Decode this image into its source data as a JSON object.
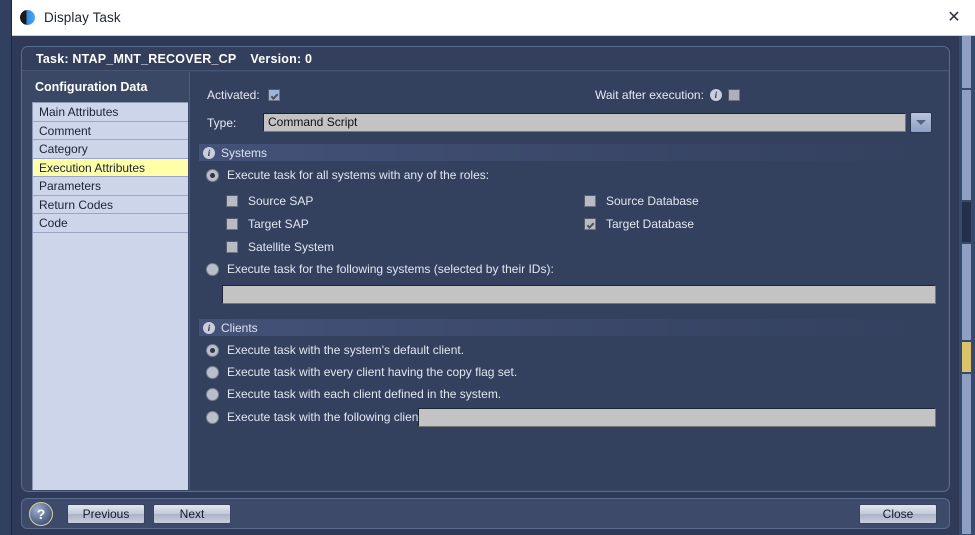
{
  "window": {
    "title": "Display Task",
    "app_icon": "app-circle-icon",
    "close_icon": "close-icon"
  },
  "panel": {
    "task_label": "Task: NTAP_MNT_RECOVER_CP",
    "version_label": "Version: 0"
  },
  "sidebar": {
    "title": "Configuration Data",
    "items": [
      {
        "label": "Main Attributes",
        "active": false
      },
      {
        "label": "Comment",
        "active": false
      },
      {
        "label": "Category",
        "active": false
      },
      {
        "label": "Execution Attributes",
        "active": true
      },
      {
        "label": "Parameters",
        "active": false
      },
      {
        "label": "Return Codes",
        "active": false
      },
      {
        "label": "Code",
        "active": false
      }
    ]
  },
  "form": {
    "activated_label": "Activated:",
    "activated_checked": true,
    "wait_label": "Wait after execution:",
    "wait_checked": false,
    "type_label": "Type:",
    "type_value": "Command Script",
    "dropdown_icon": "chevron-down-icon",
    "info_icon": "info-icon"
  },
  "systems": {
    "title": "Systems",
    "option_roles": "Execute task for all systems with any of the roles:",
    "option_roles_selected": true,
    "roles_left": [
      {
        "label": "Source SAP",
        "checked": false
      },
      {
        "label": "Target SAP",
        "checked": false
      },
      {
        "label": "Satellite System",
        "checked": false
      }
    ],
    "roles_right": [
      {
        "label": "Source Database",
        "checked": false
      },
      {
        "label": "Target Database",
        "checked": true
      }
    ],
    "option_ids": "Execute task for the following systems (selected by their IDs):",
    "option_ids_selected": false,
    "ids_value": ""
  },
  "clients": {
    "title": "Clients",
    "options": [
      {
        "label": "Execute task with the system's default client.",
        "selected": true
      },
      {
        "label": "Execute task with every client having the copy flag set.",
        "selected": false
      },
      {
        "label": "Execute task with each client defined in the system.",
        "selected": false
      },
      {
        "label": "Execute task with the following clients:",
        "selected": false
      }
    ],
    "clients_value": ""
  },
  "footer": {
    "help_label": "?",
    "previous_label": "Previous",
    "next_label": "Next",
    "close_label": "Close"
  }
}
